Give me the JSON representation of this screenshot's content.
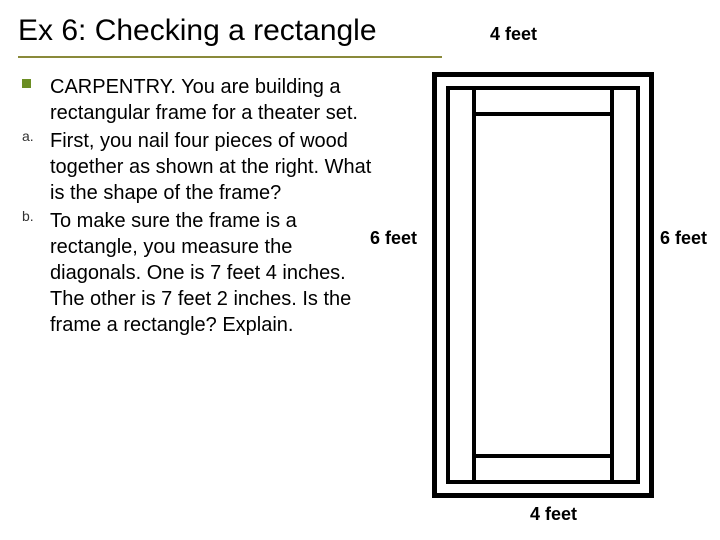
{
  "title": "Ex 6:  Checking a rectangle",
  "labels": {
    "top": "4 feet",
    "left": "6 feet",
    "right": "6 feet",
    "bottom": "4 feet"
  },
  "items": {
    "intro": "CARPENTRY.  You are building a rectangular frame for a theater set.",
    "a_marker": "a.",
    "a": "First, you nail four pieces of wood together as shown at the right.  What is the shape of the frame?",
    "b_marker": "b.",
    "b": "To make sure the frame is a rectangle, you measure the diagonals.  One is 7 feet 4 inches.  The other is 7 feet 2 inches.  Is the frame a rectangle?  Explain."
  }
}
